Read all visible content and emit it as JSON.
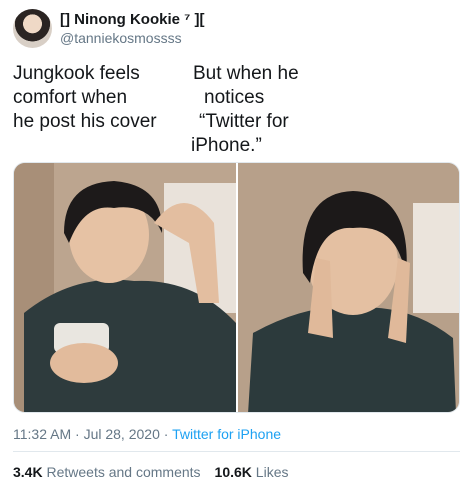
{
  "author": {
    "display_name": "[] Ninong Kookie ⁷ ][",
    "handle": "@tanniekosmossss"
  },
  "caption_left": [
    "Jungkook feels",
    "comfort when",
    "he post his cover"
  ],
  "caption_right": [
    "But when he",
    "notices",
    "“Twitter for",
    "iPhone.”"
  ],
  "media": {
    "left_photo": "person-looking-at-phone",
    "right_photo": "person-rubbing-eyes"
  },
  "meta": {
    "time": "11:32 AM",
    "separator": "·",
    "date": "Jul 28, 2020",
    "source": "Twitter for iPhone"
  },
  "stats": {
    "retweets_count": "3.4K",
    "retweets_label": "Retweets and comments",
    "likes_count": "10.6K",
    "likes_label": "Likes"
  },
  "colors": {
    "link_blue": "#1da1f2",
    "secondary_text": "#657786",
    "divider": "#e1e8ed"
  }
}
